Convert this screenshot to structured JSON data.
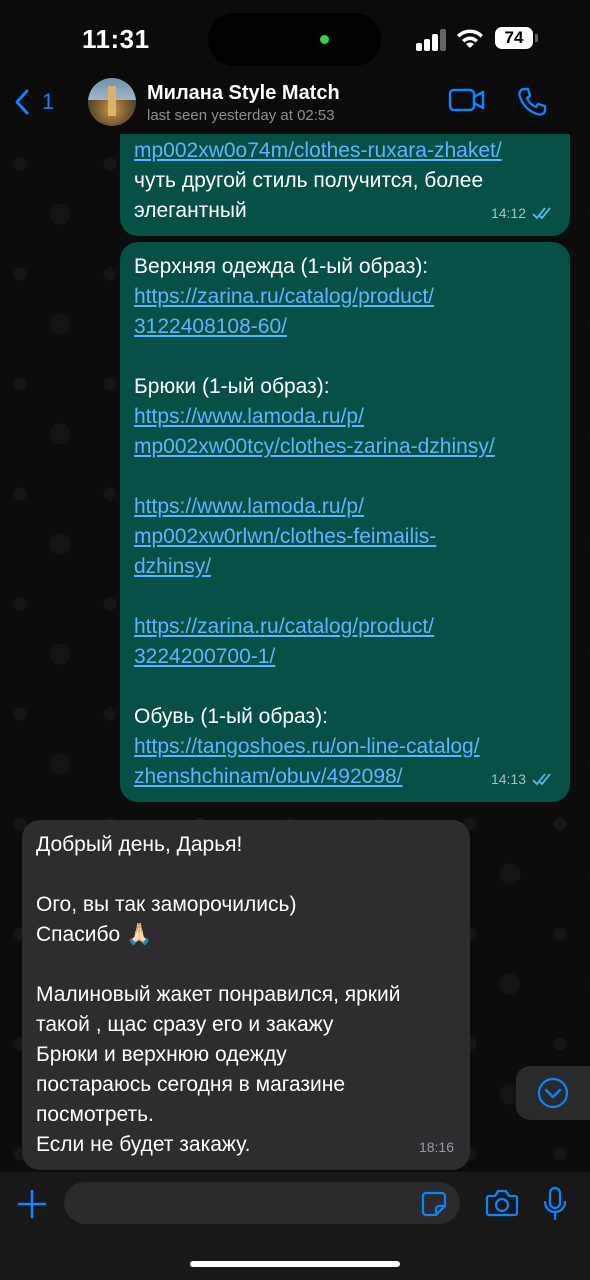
{
  "status_bar": {
    "time": "11:31",
    "battery": "74"
  },
  "header": {
    "back_count": "1",
    "contact_name": "Милана Style Match",
    "last_seen": "last seen yesterday at 02:53"
  },
  "messages": [
    {
      "id": "m1",
      "direction": "out",
      "link_lines": [
        "mp002xw0o74m/clothes-ruxara-zhaket/"
      ],
      "text_lines": [
        "чуть другой стиль получится, более",
        "элегантный"
      ],
      "time": "14:12"
    },
    {
      "id": "m2",
      "direction": "out",
      "blocks": [
        {
          "label": "Верхняя одежда (1-ый образ):",
          "links": [
            "https://zarina.ru/catalog/product/",
            "3122408108-60/"
          ]
        },
        {
          "label": "Брюки (1-ый образ):",
          "links": [
            "https://www.lamoda.ru/p/",
            "mp002xw00tcy/clothes-zarina-dzhinsy/"
          ]
        },
        {
          "label": "",
          "links": [
            "https://www.lamoda.ru/p/",
            "mp002xw0rlwn/clothes-feimailis-",
            "dzhinsy/"
          ]
        },
        {
          "label": "",
          "links": [
            "https://zarina.ru/catalog/product/",
            "3224200700-1/"
          ]
        },
        {
          "label": "Обувь (1-ый образ):",
          "links": [
            "https://tangoshoes.ru/on-line-catalog/",
            "zhenshchinam/obuv/492098/"
          ]
        }
      ],
      "time": "14:13"
    },
    {
      "id": "m3",
      "direction": "in",
      "text_lines": [
        "Добрый день, Дарья!",
        "",
        "Ого, вы так заморочились)",
        "Спасибо 🙏🏻",
        "",
        "Малиновый жакет понравился, яркий",
        "такой , щас сразу его и закажу",
        "Брюки и верхнюю одежду",
        "постараюсь сегодня в магазине",
        "посмотреть.",
        "Если не будет закажу."
      ],
      "time": "18:16"
    }
  ],
  "colors": {
    "accent": "#0a84ff",
    "outgoing": "#065046",
    "incoming": "#2d2d30",
    "link": "#5fb2ff",
    "read_ticks": "#53bdeb"
  },
  "icons": [
    "back-chevron-icon",
    "video-call-icon",
    "phone-icon",
    "scroll-down-icon",
    "plus-icon",
    "sticker-icon",
    "camera-icon",
    "microphone-icon"
  ]
}
